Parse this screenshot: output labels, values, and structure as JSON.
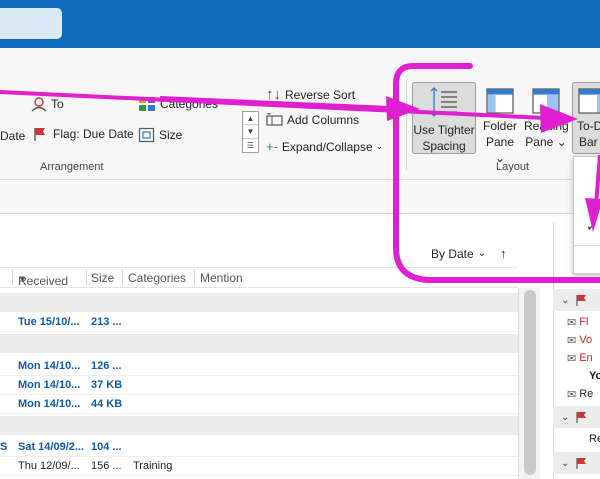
{
  "ribbon": {
    "to_label": "To",
    "categories_label": "Categories",
    "date_label": "Date",
    "flag_due_label": "Flag: Due Date",
    "size_label": "Size",
    "arrangement_label": "Arrangement",
    "reverse_sort_label": "Reverse Sort",
    "add_columns_label": "Add Columns",
    "expand_collapse_label": "Expand/Collapse",
    "use_tighter_line1": "Use Tighter",
    "use_tighter_line2": "Spacing",
    "folder_pane_line1": "Folder",
    "folder_pane_line2": "Pane",
    "reading_pane_line1": "Reading",
    "reading_pane_line2": "Pane",
    "todo_bar_line1": "To-Do",
    "todo_bar_line2": "Bar",
    "layout_label": "Layout"
  },
  "list": {
    "sort_label": "By Date",
    "columns": [
      "Received",
      "Size",
      "Categories",
      "Mention"
    ],
    "rows": [
      {
        "received": "Tue 15/10/...",
        "size": "213 ...",
        "categories": ""
      },
      {
        "received": "Mon 14/10...",
        "size": "126 ...",
        "categories": ""
      },
      {
        "received": "Mon 14/10...",
        "size": "37 KB",
        "categories": ""
      },
      {
        "received": "Mon 14/10...",
        "size": "44 KB",
        "categories": ""
      },
      {
        "received": "Sat 14/09/2...",
        "size": "104 ...",
        "categories": "",
        "prefix": "S"
      },
      {
        "received": "Thu 12/09/...",
        "size": "156 ...",
        "categories": "Training"
      }
    ]
  },
  "todo": {
    "items": [
      "Fl",
      "Vo",
      "En",
      "Yo",
      "Re",
      "Re"
    ]
  },
  "colors": {
    "title_bar": "#0f6cbd",
    "annotation_magenta": "#e020d0",
    "unread_blue": "#0f5aa8",
    "flag_red": "#d13438"
  }
}
